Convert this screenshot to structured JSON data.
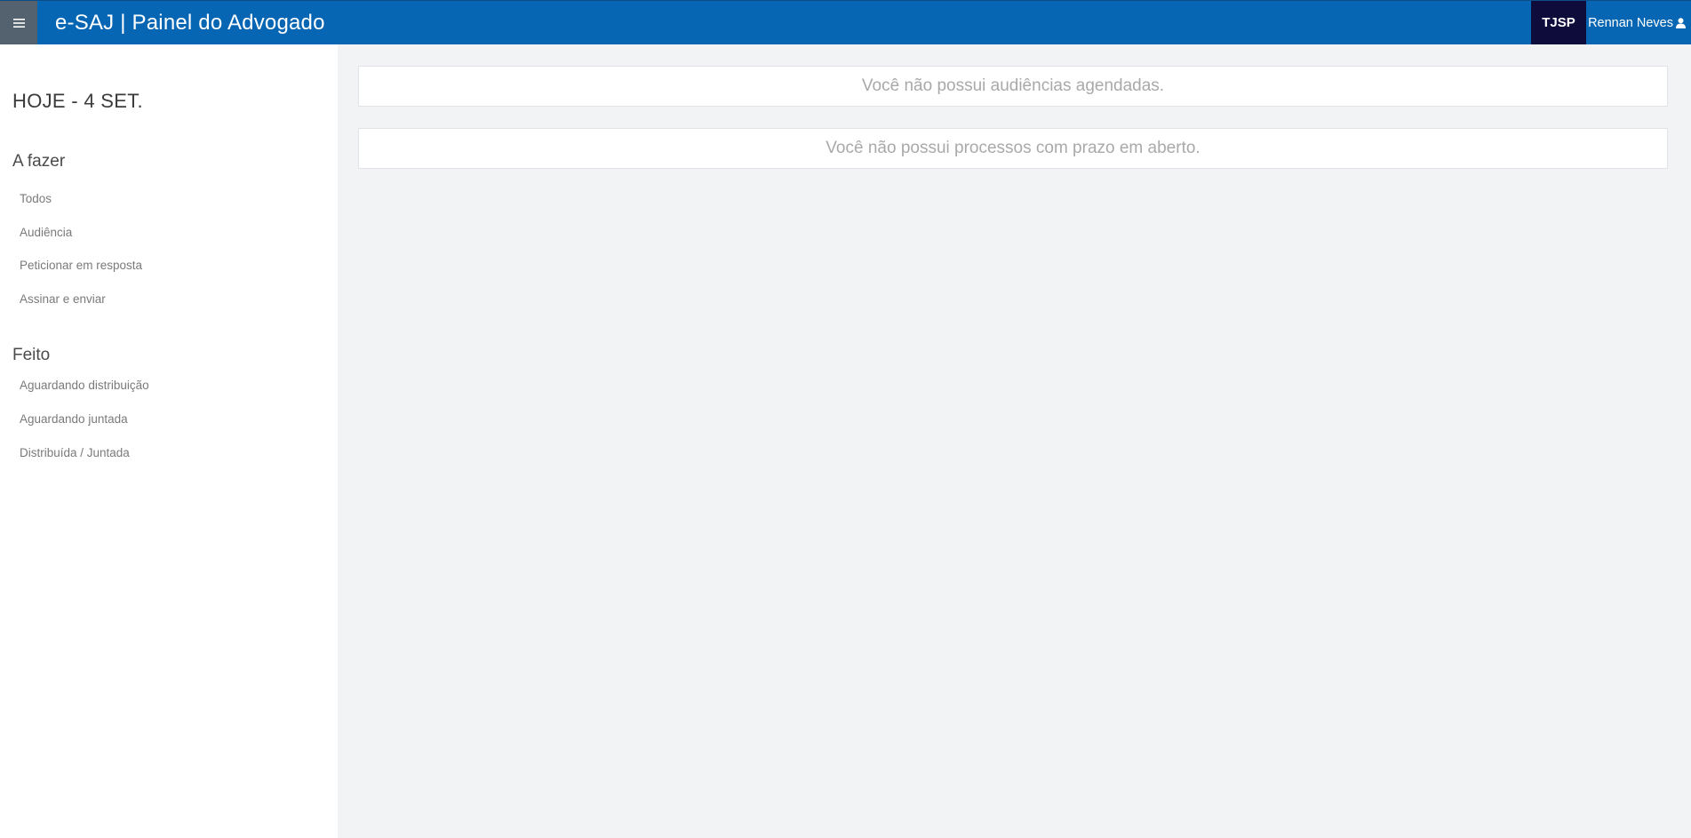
{
  "header": {
    "menu_icon": "hamburger-icon",
    "title": "e-SAJ | Painel do Advogado",
    "court": "TJSP",
    "user_name": "Rennan Neves",
    "user_icon": "user-icon",
    "colors": {
      "bar": "#0766b3",
      "menu_button": "#54616e",
      "court_badge": "#0d0c3b"
    }
  },
  "sidebar": {
    "today": "HOJE - 4 SET.",
    "todo": {
      "title": "A fazer",
      "items": [
        "Todos",
        "Audiência",
        "Peticionar em resposta",
        "Assinar e enviar"
      ]
    },
    "done": {
      "title": "Feito",
      "items": [
        "Aguardando distribuição",
        "Aguardando juntada",
        "Distribuída / Juntada"
      ]
    }
  },
  "main": {
    "hearings_notice": "Você não possui audiências agendadas.",
    "deadlines_notice": "Você não possui processos com prazo em aberto."
  }
}
